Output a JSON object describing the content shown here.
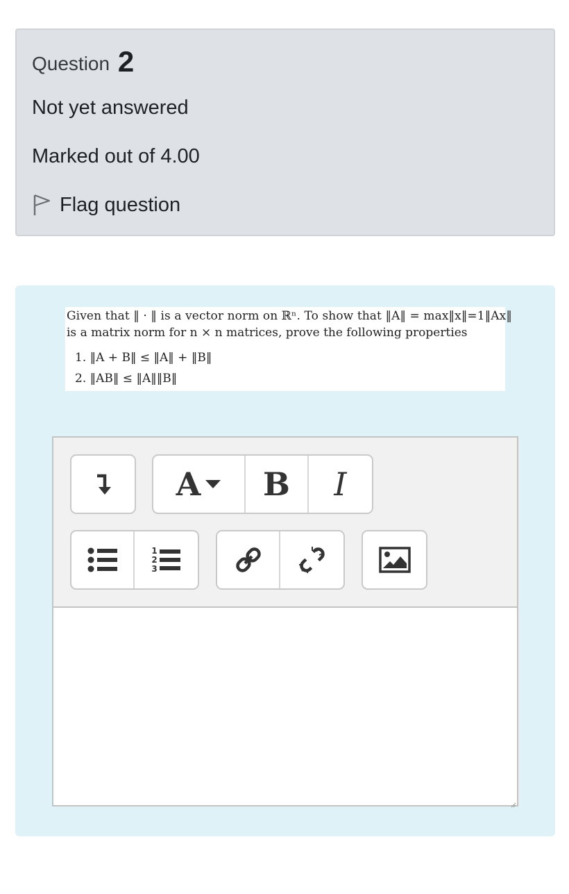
{
  "info": {
    "question_word": "Question",
    "question_number": "2",
    "state": "Not yet answered",
    "grade": "Marked out of 4.00",
    "flag_label": "Flag question",
    "flag_icon": "flag-outline-icon"
  },
  "question": {
    "intro_line1": "Given that ‖ · ‖ is a vector norm on ℝⁿ. To show that ‖A‖ = max‖x‖=1‖Ax‖",
    "intro_line2": "is a matrix norm for n × n matrices, prove the following properties",
    "properties": [
      "1. ‖A + B‖ ≤ ‖A‖ + ‖B‖",
      "2. ‖AB‖ ≤ ‖A‖‖B‖"
    ]
  },
  "editor": {
    "toolbar": {
      "row1": [
        {
          "name": "show-more-buttons",
          "icon": "arrow-down-return-icon"
        },
        {
          "name": "paragraph-styles",
          "label": "A",
          "icon": "caret-down-icon"
        },
        {
          "name": "bold",
          "label": "B"
        },
        {
          "name": "italic",
          "label": "I"
        }
      ],
      "row2": [
        {
          "name": "unordered-list",
          "icon": "bullet-list-icon"
        },
        {
          "name": "ordered-list",
          "icon": "numbered-list-icon",
          "numbers": [
            "1",
            "2",
            "3"
          ]
        },
        {
          "name": "link",
          "icon": "link-icon"
        },
        {
          "name": "unlink",
          "icon": "unlink-icon"
        },
        {
          "name": "image",
          "icon": "image-icon"
        }
      ]
    },
    "content": ""
  },
  "colors": {
    "info_bg": "#dee2e6",
    "content_bg": "#def2f8",
    "toolbar_bg": "#f1f1f1",
    "text": "#1d2125"
  }
}
